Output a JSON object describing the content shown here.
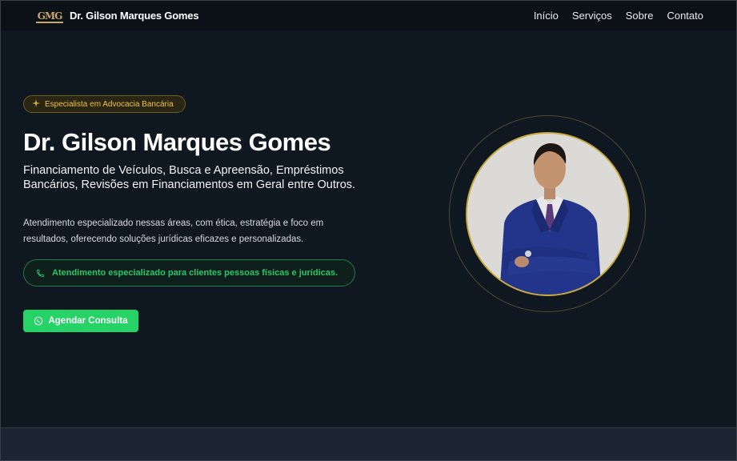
{
  "header": {
    "logo_text": "GMG",
    "brand": "Dr. Gilson Marques Gomes",
    "nav": [
      "Início",
      "Serviços",
      "Sobre",
      "Contato"
    ]
  },
  "hero": {
    "badge": "Especialista em Advocacia Bancária",
    "title": "Dr. Gilson Marques Gomes",
    "subtitle": "Financiamento de Veículos, Busca e Apreensão, Empréstimos Bancários, Revisões em Financiamentos em Geral entre Outros.",
    "description": "Atendimento especializado nessas áreas, com ética, estratégia e foco em resultados, oferecendo soluções jurídicas eficazes e personalizadas.",
    "info": "Atendimento especializado para clientes pessoas físicas e jurídicas.",
    "cta": "Agendar Consulta"
  },
  "colors": {
    "background": "#0f1721",
    "accent_gold": "#f0c043",
    "accent_green": "#25d366"
  },
  "icons": {
    "badge": "sparkle-icon",
    "info": "phone-icon",
    "cta": "whatsapp-icon"
  }
}
